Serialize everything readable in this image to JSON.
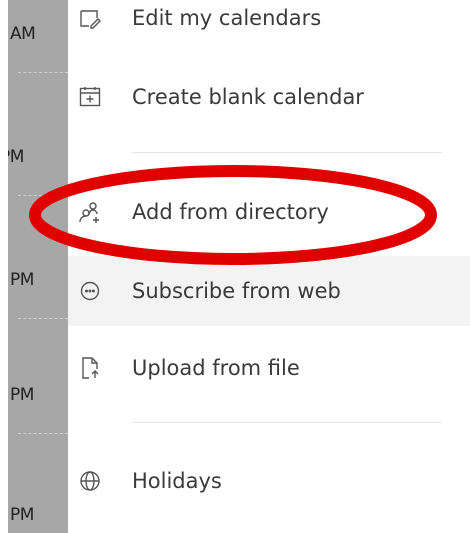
{
  "background_times": [
    "AM",
    "PM",
    "PM",
    "PM",
    "PM"
  ],
  "menu": {
    "items": [
      {
        "label": "Edit my calendars",
        "icon": "edit-calendar-icon"
      },
      {
        "label": "Create blank calendar",
        "icon": "calendar-add-icon"
      },
      {
        "label": "Add from directory",
        "icon": "people-add-icon"
      },
      {
        "label": "Subscribe from web",
        "icon": "more-circle-icon"
      },
      {
        "label": "Upload from file",
        "icon": "document-arrow-up-icon"
      },
      {
        "label": "Holidays",
        "icon": "globe-icon"
      }
    ]
  },
  "annotation_color": "#e00000"
}
